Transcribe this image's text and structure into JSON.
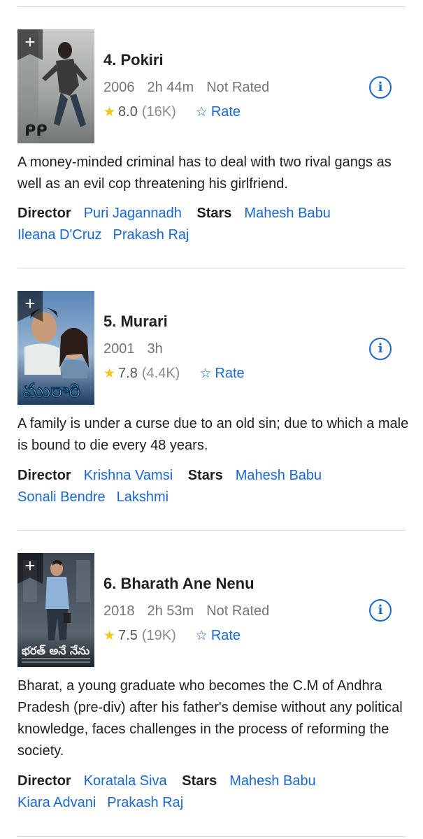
{
  "items": [
    {
      "rank_title": "4. Pokiri",
      "year": "2006",
      "runtime": "2h 44m",
      "certificate": "Not Rated",
      "rating": "8.0",
      "votes": "(16K)",
      "rate_label": "Rate",
      "description": "A money-minded criminal has to deal with two rival gangs as well as an evil cop threatening his girlfriend.",
      "director_label": "Director",
      "director": "Puri Jagannadh",
      "stars_label": "Stars",
      "stars": [
        "Mahesh Babu",
        "Ileana D'Cruz",
        "Prakash Raj"
      ]
    },
    {
      "rank_title": "5. Murari",
      "year": "2001",
      "runtime": "3h",
      "certificate": "",
      "rating": "7.8",
      "votes": "(4.4K)",
      "rate_label": "Rate",
      "description": "A family is under a curse due to an old sin; due to which a male is bound to die every 48 years.",
      "director_label": "Director",
      "director": "Krishna Vamsi",
      "stars_label": "Stars",
      "stars": [
        "Mahesh Babu",
        "Sonali Bendre",
        "Lakshmi"
      ]
    },
    {
      "rank_title": "6. Bharath Ane Nenu",
      "year": "2018",
      "runtime": "2h 53m",
      "certificate": "Not Rated",
      "rating": "7.5",
      "votes": "(19K)",
      "rate_label": "Rate",
      "description": "Bharat, a young graduate who becomes the C.M of Andhra Pradesh (pre-div) after his father's demise without any political knowledge, faces challenges in the process of reforming the society.",
      "director_label": "Director",
      "director": "Koratala Siva",
      "stars_label": "Stars",
      "stars": [
        "Mahesh Babu",
        "Kiara Advani",
        "Prakash Raj"
      ]
    }
  ],
  "icons": {
    "add": "+",
    "star": "★",
    "rate_star": "☆",
    "info": "i"
  },
  "colors": {
    "link": "#1967d2",
    "star": "#f5c518",
    "meta": "#757575"
  }
}
